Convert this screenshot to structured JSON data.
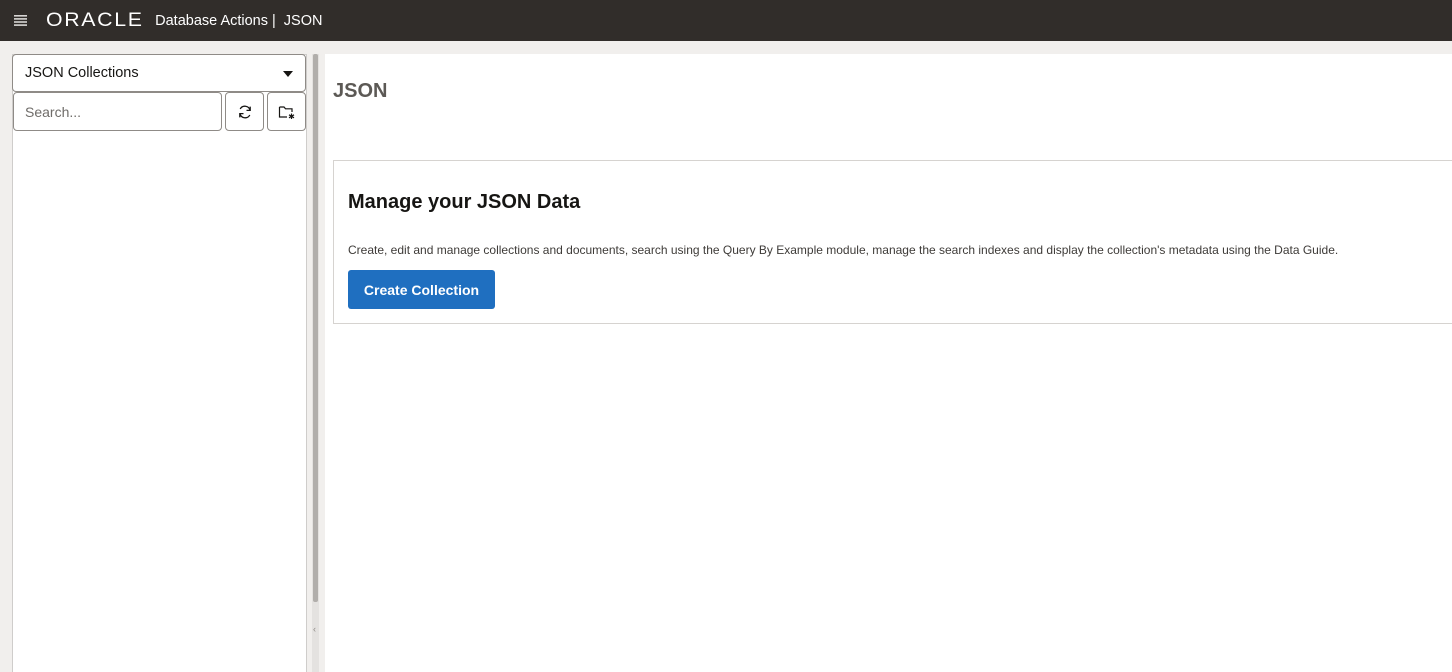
{
  "header": {
    "brand": "ORACLE",
    "app_name": "Database Actions",
    "separator": "|",
    "breadcrumb": "JSON",
    "menu_icon": "hamburger-icon"
  },
  "sidebar": {
    "selector_value": "JSON Collections",
    "search_placeholder": "Search...",
    "refresh_icon": "refresh-icon",
    "new_collection_icon": "new-folder-icon"
  },
  "main": {
    "page_title": "JSON",
    "card": {
      "title": "Manage your JSON Data",
      "description": "Create, edit and manage collections and documents, search using the Query By Example module, manage the search indexes and display the collection's metadata using the Data Guide.",
      "button_label": "Create Collection"
    }
  },
  "colors": {
    "header_bg": "#312d2a",
    "primary_button": "#1f6fc0",
    "page_bg": "#f1efed"
  }
}
